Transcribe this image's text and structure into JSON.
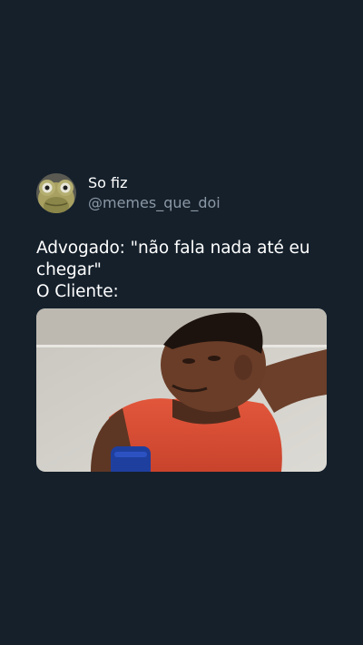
{
  "tweet": {
    "display_name": "So fiz",
    "handle": "@memes_que_doi",
    "lines": [
      "Advogado: \"não fala nada até eu",
      "chegar\"",
      "O Cliente:"
    ]
  },
  "icons": {
    "avatar": "frog-face-avatar"
  },
  "colors": {
    "background": "#15202b",
    "text": "#ffffff",
    "secondary_text": "#8b98a5"
  }
}
